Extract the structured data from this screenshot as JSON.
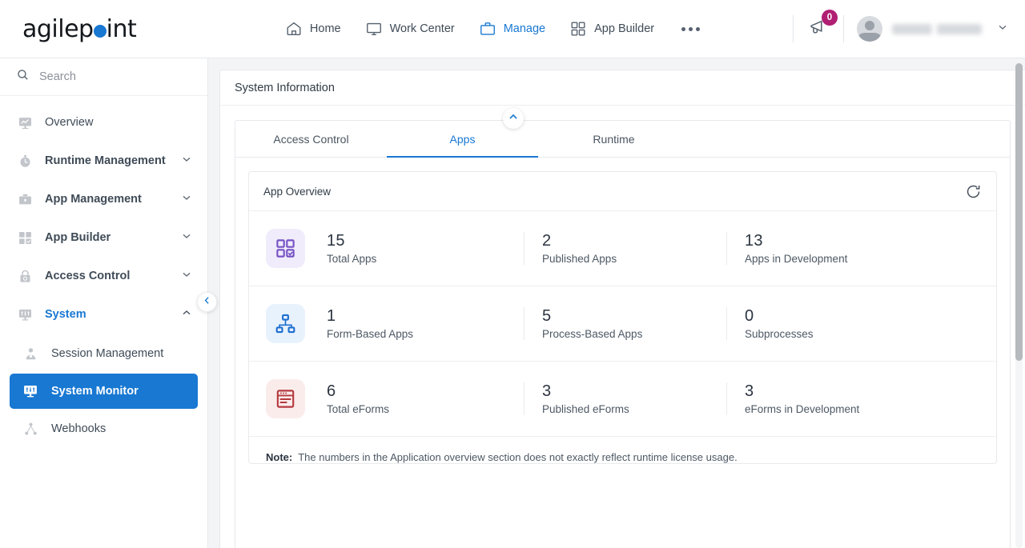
{
  "brand": {
    "name_part1": "agilep",
    "name_part2": "int",
    "dot_color": "#1878d2"
  },
  "topnav": {
    "items": [
      {
        "label": "Home",
        "icon": "home-icon",
        "active": false
      },
      {
        "label": "Work Center",
        "icon": "monitor-icon",
        "active": false
      },
      {
        "label": "Manage",
        "icon": "briefcase-icon",
        "active": true
      },
      {
        "label": "App Builder",
        "icon": "grid-icon",
        "active": false
      }
    ],
    "more_label": "more-options",
    "notifications": {
      "icon": "megaphone-icon",
      "count": "0",
      "badge_color": "#b01f72"
    },
    "user": {
      "name": "",
      "avatar": "user-avatar-icon",
      "caret": "chevron-down-icon"
    }
  },
  "sidebar": {
    "search": {
      "placeholder": "Search",
      "icon": "search-icon",
      "value": ""
    },
    "items": [
      {
        "label": "Overview",
        "icon": "overview-monitor-icon",
        "expandable": false,
        "bold": false
      },
      {
        "label": "Runtime Management",
        "icon": "stopwatch-icon",
        "expandable": true,
        "expanded": false,
        "bold": true
      },
      {
        "label": "App Management",
        "icon": "briefcase-icon",
        "expandable": true,
        "expanded": false,
        "bold": true
      },
      {
        "label": "App Builder",
        "icon": "grid-check-icon",
        "expandable": true,
        "expanded": false,
        "bold": true
      },
      {
        "label": "Access Control",
        "icon": "lock-icon",
        "expandable": true,
        "expanded": false,
        "bold": true
      },
      {
        "label": "System",
        "icon": "system-monitor-icon",
        "expandable": true,
        "expanded": true,
        "bold": true
      }
    ],
    "subitems": [
      {
        "label": "Session Management",
        "icon": "session-user-icon",
        "selected": false
      },
      {
        "label": "System Monitor",
        "icon": "system-monitor-icon",
        "selected": true
      },
      {
        "label": "Webhooks",
        "icon": "webhooks-icon",
        "selected": false
      }
    ],
    "collapse_icon": "chevron-left-icon",
    "selected_color": "#1878d2"
  },
  "panel": {
    "title": "System Information",
    "collapse_icon": "chevron-up-icon",
    "tabs": [
      {
        "label": "Access Control",
        "active": false
      },
      {
        "label": "Apps",
        "active": true
      },
      {
        "label": "Runtime",
        "active": false
      }
    ]
  },
  "app_overview": {
    "title": "App Overview",
    "refresh_icon": "refresh-icon",
    "rows": [
      {
        "icon": "apps-grid-check-icon",
        "icon_color": "#7652c4",
        "icon_bg": "#f0ecfb",
        "cells": [
          {
            "value": "15",
            "label": "Total Apps"
          },
          {
            "value": "2",
            "label": "Published Apps"
          },
          {
            "value": "13",
            "label": "Apps in Development"
          }
        ]
      },
      {
        "icon": "hierarchy-icon",
        "icon_color": "#1f6fd0",
        "icon_bg": "#e8f2fd",
        "cells": [
          {
            "value": "1",
            "label": "Form-Based Apps"
          },
          {
            "value": "5",
            "label": "Process-Based Apps"
          },
          {
            "value": "0",
            "label": "Subprocesses"
          }
        ]
      },
      {
        "icon": "eform-icon",
        "icon_color": "#b53a3f",
        "icon_bg": "#fbecec",
        "cells": [
          {
            "value": "6",
            "label": "Total eForms"
          },
          {
            "value": "3",
            "label": "Published eForms"
          },
          {
            "value": "3",
            "label": "eForms in Development"
          }
        ]
      }
    ],
    "note_label": "Note:",
    "note_text": "The numbers in the Application overview section does not exactly reflect runtime license usage."
  },
  "scrollbar": {
    "name": "vertical-scrollbar"
  }
}
